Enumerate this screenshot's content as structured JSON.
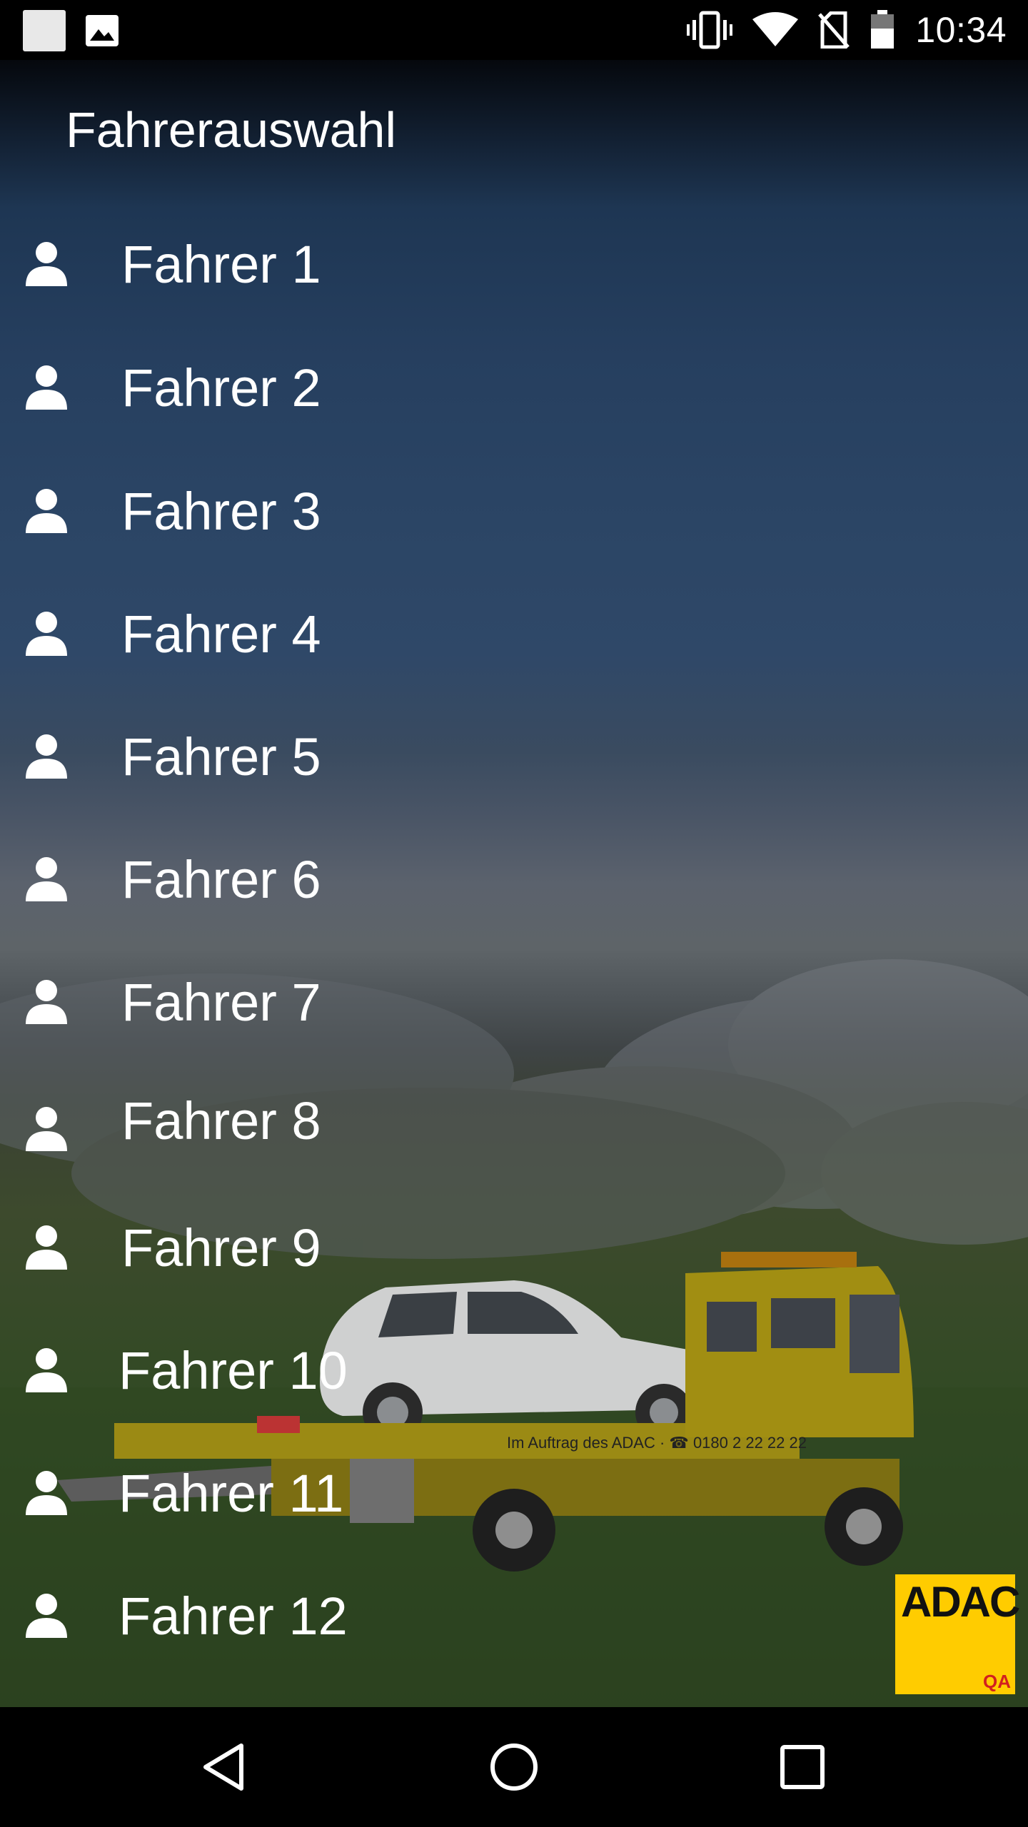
{
  "status_bar": {
    "time": "10:34",
    "icons": [
      "notification-square-icon",
      "image-icon",
      "vibrate-icon",
      "wifi-icon",
      "no-sim-icon",
      "battery-icon"
    ]
  },
  "screen": {
    "title": "Fahrerauswahl",
    "drivers": [
      {
        "label": "Fahrer 1"
      },
      {
        "label": "Fahrer 2"
      },
      {
        "label": "Fahrer 3"
      },
      {
        "label": "Fahrer 4"
      },
      {
        "label": "Fahrer 5"
      },
      {
        "label": "Fahrer 6"
      },
      {
        "label": "Fahrer 7"
      },
      {
        "label": "Fahrer 8"
      },
      {
        "label": "Fahrer 9"
      },
      {
        "label": "Fahrer 10"
      },
      {
        "label": "Fahrer 11"
      },
      {
        "label": "Fahrer 12"
      }
    ],
    "background_art": {
      "truck_text": "Im Auftrag des ADAC · ☎ 0180 2 22 22 22"
    },
    "logo": {
      "text": "ADAC",
      "subtext": "QA",
      "color": "#ffcc00"
    }
  },
  "nav_bar": {
    "buttons": [
      "back-icon",
      "home-icon",
      "recents-icon"
    ]
  }
}
